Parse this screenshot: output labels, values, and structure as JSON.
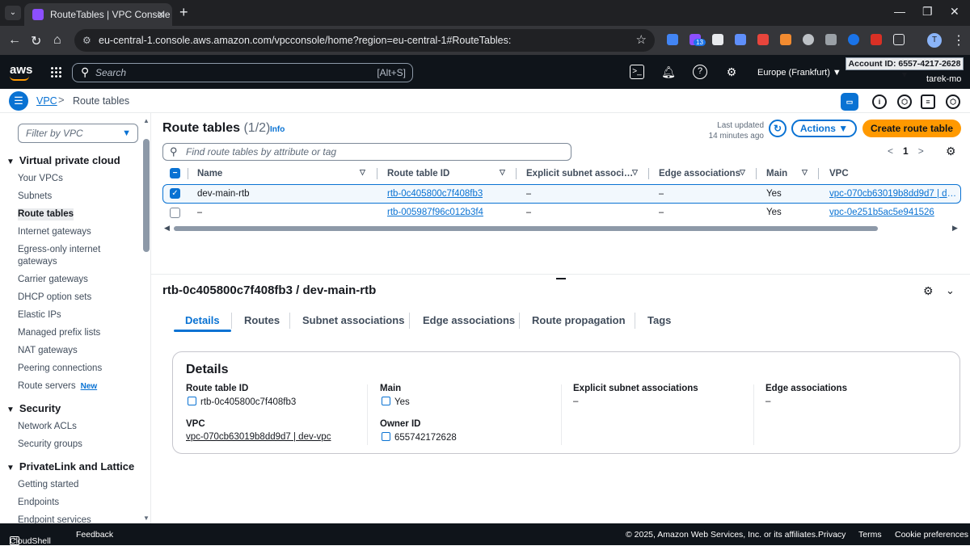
{
  "browser": {
    "tab_title": "RouteTables | VPC Console",
    "url": "eu-central-1.console.aws.amazon.com/vpcconsole/home?region=eu-central-1#RouteTables:",
    "extension_badge": "13",
    "profile_initial": "T"
  },
  "aws_nav": {
    "logo": "aws",
    "search_placeholder": "Search",
    "search_shortcut": "[Alt+S]",
    "region": "Europe (Frankfurt) ▼",
    "account": "Account ID: 6557-4217-2628 ▼",
    "user": "tarek-mo"
  },
  "breadcrumb": {
    "root": "VPC",
    "current": "Route tables"
  },
  "sidebar": {
    "filter_placeholder": "Filter by VPC",
    "sections": [
      {
        "title": "Virtual private cloud",
        "items": [
          "Your VPCs",
          "Subnets",
          "Route tables",
          "Internet gateways",
          "Egress-only internet gateways",
          "Carrier gateways",
          "DHCP option sets",
          "Elastic IPs",
          "Managed prefix lists",
          "NAT gateways",
          "Peering connections",
          "Route servers"
        ]
      },
      {
        "title": "Security",
        "items": [
          "Network ACLs",
          "Security groups"
        ]
      },
      {
        "title": "PrivateLink and Lattice",
        "items": [
          "Getting started",
          "Endpoints",
          "Endpoint services"
        ]
      }
    ],
    "new_tag": "New"
  },
  "main": {
    "title": "Route tables",
    "count": "(1/2)",
    "info": "Info",
    "last_updated_label": "Last updated",
    "last_updated_value": "14 minutes ago",
    "actions_label": "Actions ▼",
    "create_label": "Create route table",
    "search_placeholder": "Find route tables by attribute or tag",
    "page": "1",
    "columns": [
      "Name",
      "Route table ID",
      "Explicit subnet associ…",
      "Edge associations",
      "Main",
      "VPC"
    ],
    "rows": [
      {
        "selected": true,
        "name": "dev-main-rtb",
        "id": "rtb-0c405800c7f408fb3",
        "explicit": "–",
        "edge": "–",
        "main": "Yes",
        "vpc": "vpc-070cb63019b8dd9d7 | dev-vpc"
      },
      {
        "selected": false,
        "name": "–",
        "id": "rtb-005987f96c012b3f4",
        "explicit": "–",
        "edge": "–",
        "main": "Yes",
        "vpc": "vpc-0e251b5ac5e941526"
      }
    ]
  },
  "details": {
    "heading": "rtb-0c405800c7f408fb3 / dev-main-rtb",
    "tabs": [
      "Details",
      "Routes",
      "Subnet associations",
      "Edge associations",
      "Route propagation",
      "Tags"
    ],
    "card_title": "Details",
    "route_table_id_label": "Route table ID",
    "route_table_id": "rtb-0c405800c7f408fb3",
    "vpc_label": "VPC",
    "vpc": "vpc-070cb63019b8dd9d7 | dev-vpc",
    "main_label": "Main",
    "main": "Yes",
    "owner_label": "Owner ID",
    "owner": "655742172628",
    "explicit_label": "Explicit subnet associations",
    "explicit": "–",
    "edge_label": "Edge associations",
    "edge": "–"
  },
  "footer": {
    "cloudshell": "CloudShell",
    "feedback": "Feedback",
    "copyright": "© 2025, Amazon Web Services, Inc. or its affiliates.",
    "privacy": "Privacy",
    "terms": "Terms",
    "cookies": "Cookie preferences"
  },
  "colors": {
    "accent": "#0972d3",
    "primary_button": "#ff9900",
    "nav_bg": "#0f141a"
  }
}
